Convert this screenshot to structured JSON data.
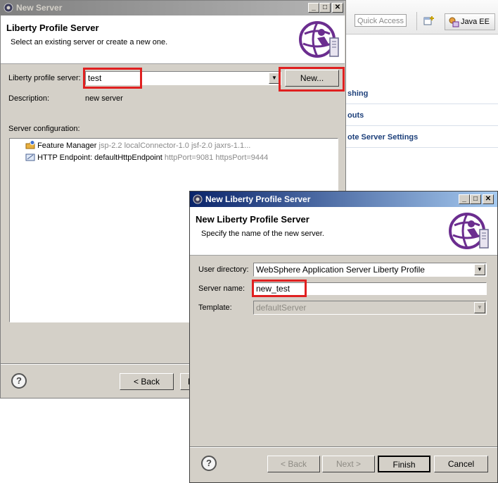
{
  "eclipse": {
    "quick_access_placeholder": "Quick Access",
    "perspective_label": "Java EE",
    "sections": [
      "shing",
      "outs",
      "ote Server Settings"
    ]
  },
  "new_server_dialog": {
    "title": "New Server",
    "banner_title": "Liberty Profile Server",
    "banner_subtitle": "Select an existing server or create a new one.",
    "server_label": "Liberty profile server:",
    "server_value": "test",
    "new_button": "New...",
    "description_label": "Description:",
    "description_value": "new server",
    "config_label": "Server configuration:",
    "tree": [
      {
        "name": "Feature Manager",
        "detail": "jsp-2.2 localConnector-1.0 jsf-2.0 jaxrs-1.1..."
      },
      {
        "name": "HTTP Endpoint: defaultHttpEndpoint",
        "detail": "httpPort=9081 httpsPort=9444"
      }
    ],
    "help": "?",
    "back_button": "< Back",
    "next_button_partial": "N"
  },
  "new_liberty_dialog": {
    "title": "New Liberty Profile Server",
    "banner_title": "New Liberty Profile Server",
    "banner_subtitle": "Specify the name of the new server.",
    "user_dir_label": "User directory:",
    "user_dir_value": "WebSphere Application Server Liberty Profile",
    "server_name_label": "Server name:",
    "server_name_value": "new_test",
    "template_label": "Template:",
    "template_value": "defaultServer",
    "help": "?",
    "back_button": "< Back",
    "next_button": "Next >",
    "finish_button": "Finish",
    "cancel_button": "Cancel"
  },
  "colors": {
    "highlight_red": "#e02020",
    "active_title": "#0a246a",
    "inactive_title": "#808080",
    "dialog_face": "#d4d0c8",
    "liberty_purple": "#6b2d8f"
  }
}
